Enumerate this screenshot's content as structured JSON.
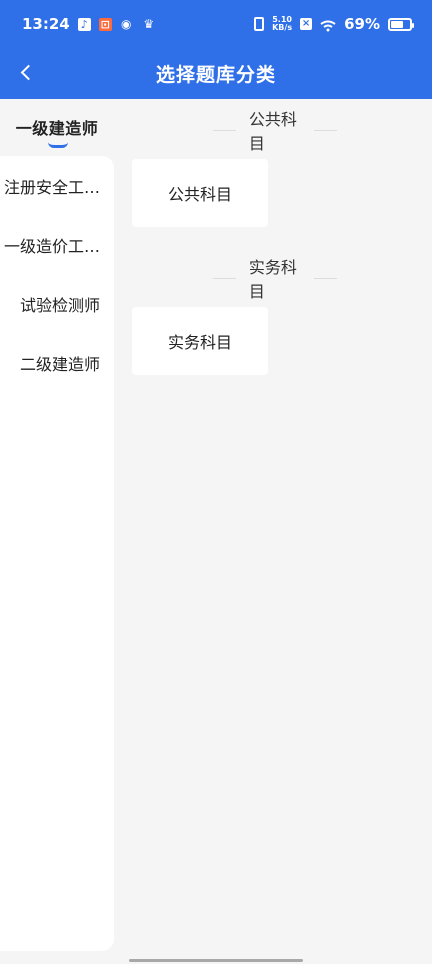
{
  "status": {
    "time": "13:24",
    "speed_top": "5.10",
    "speed_bottom": "KB/s",
    "battery": "69%",
    "battery_level": 0.69,
    "icons": [
      "tiktok-icon",
      "shop-icon",
      "app-badge-icon",
      "crown-icon",
      "vibrate-icon",
      "sim-off-icon",
      "wifi-icon",
      "battery-icon"
    ]
  },
  "header": {
    "title": "选择题库分类",
    "back_icon": "back-arrow-icon"
  },
  "sidebar": {
    "selected": "一级建造师",
    "items": [
      {
        "label": "注册安全工…"
      },
      {
        "label": "一级造价工…"
      },
      {
        "label": "试验检测师"
      },
      {
        "label": "二级建造师"
      }
    ]
  },
  "content": {
    "sections": [
      {
        "title": "公共科目",
        "cards": [
          {
            "label": "公共科目"
          }
        ]
      },
      {
        "title": "实务科目",
        "cards": [
          {
            "label": "实务科目"
          }
        ]
      }
    ]
  },
  "colors": {
    "accent": "#2f6fe8",
    "background": "#f5f5f5",
    "card": "#ffffff"
  }
}
